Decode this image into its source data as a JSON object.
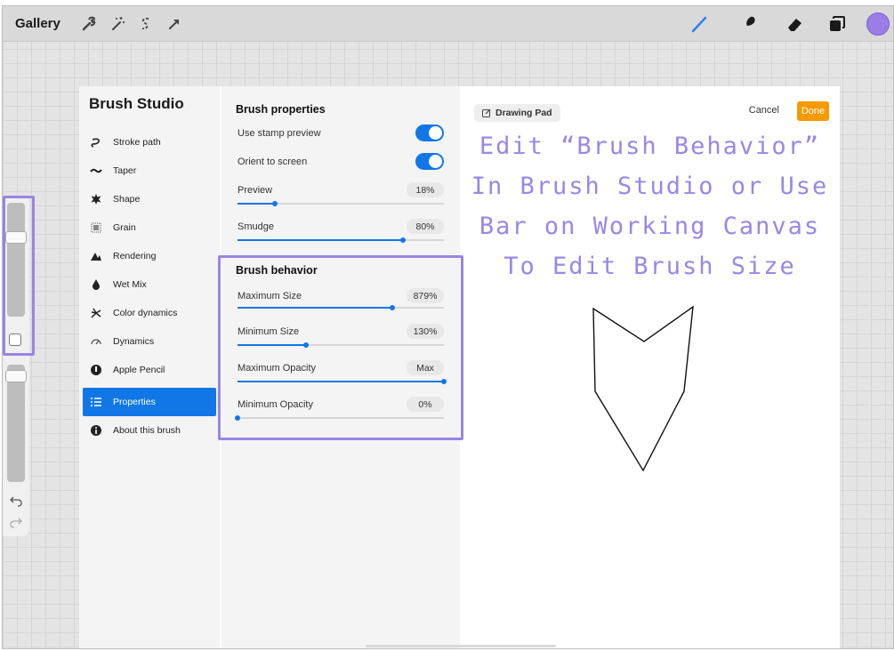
{
  "topbar": {
    "gallery_label": "Gallery",
    "left_tools": [
      "wrench-icon",
      "magic-wand-icon",
      "selection-icon",
      "transform-arrow-icon"
    ],
    "right_tools": [
      "brush-icon",
      "smudge-icon",
      "eraser-icon",
      "layers-icon"
    ],
    "current_color": "#9b7de8"
  },
  "sidebar": {
    "size_slider": 0.25,
    "opacity_slider": 0.05
  },
  "brush_studio": {
    "title": "Brush Studio",
    "nav_items": [
      {
        "label": "Stroke path",
        "icon": "stroke-path-icon"
      },
      {
        "label": "Taper",
        "icon": "taper-icon"
      },
      {
        "label": "Shape",
        "icon": "shape-icon"
      },
      {
        "label": "Grain",
        "icon": "grain-icon"
      },
      {
        "label": "Rendering",
        "icon": "rendering-icon"
      },
      {
        "label": "Wet Mix",
        "icon": "wet-mix-icon"
      },
      {
        "label": "Color dynamics",
        "icon": "color-dynamics-icon"
      },
      {
        "label": "Dynamics",
        "icon": "dynamics-icon"
      },
      {
        "label": "Apple Pencil",
        "icon": "apple-pencil-icon"
      },
      {
        "label": "Properties",
        "icon": "properties-icon",
        "active": true
      },
      {
        "label": "About this brush",
        "icon": "info-icon"
      }
    ],
    "properties": {
      "title": "Brush properties",
      "use_stamp_preview": {
        "label": "Use stamp preview",
        "on": true
      },
      "orient_to_screen": {
        "label": "Orient to screen",
        "on": true
      },
      "preview": {
        "label": "Preview",
        "value": "18%",
        "fraction": 0.18
      },
      "smudge": {
        "label": "Smudge",
        "value": "80%",
        "fraction": 0.8
      }
    },
    "behavior": {
      "title": "Brush behavior",
      "max_size": {
        "label": "Maximum Size",
        "value": "879%",
        "fraction": 0.75
      },
      "min_size": {
        "label": "Minimum Size",
        "value": "130%",
        "fraction": 0.33
      },
      "max_opacity": {
        "label": "Maximum Opacity",
        "value": "Max",
        "fraction": 1.0
      },
      "min_opacity": {
        "label": "Minimum Opacity",
        "value": "0%",
        "fraction": 0.0
      }
    }
  },
  "drawing_pad": {
    "label": "Drawing Pad",
    "cancel_label": "Cancel",
    "done_label": "Done",
    "annotation": [
      "Edit “Brush Behavior”",
      "In Brush Studio or Use",
      "Bar on Working Canvas",
      "To Edit Brush Size"
    ]
  },
  "colors": {
    "accent": "#1277e6",
    "done": "#f59a00",
    "annotation": "#9a87e6"
  }
}
